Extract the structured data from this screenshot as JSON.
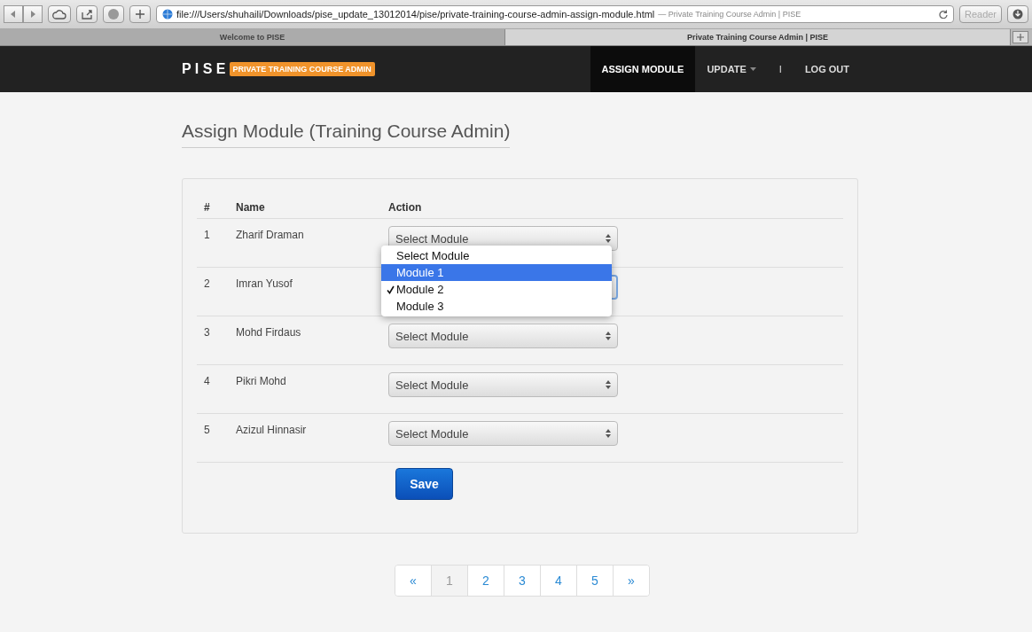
{
  "browser": {
    "url": "file:///Users/shuhaili/Downloads/pise_update_13012014/pise/private-training-course-admin-assign-module.html",
    "page_title": "— Private Training Course Admin | PISE",
    "reader": "Reader",
    "tabs": [
      {
        "label": "Welcome to PISE",
        "selected": false
      },
      {
        "label": "Private Training Course Admin | PISE",
        "selected": true
      }
    ]
  },
  "navbar": {
    "brand": "P I S E",
    "badge": "PRIVATE TRAINING COURSE ADMIN",
    "items": [
      {
        "label": "ASSIGN MODULE",
        "selected": true,
        "kind": "link"
      },
      {
        "label": "UPDATE",
        "selected": false,
        "kind": "dropdown"
      },
      {
        "label": "I",
        "kind": "separator"
      },
      {
        "label": "LOG OUT",
        "selected": false,
        "kind": "link"
      }
    ]
  },
  "heading": "Assign Module (Training Course Admin)",
  "table": {
    "columns": [
      "#",
      "Name",
      "Action"
    ],
    "rows": [
      {
        "number": "1",
        "name": "Zharif Draman",
        "value": "Select Module",
        "focused": false
      },
      {
        "number": "2",
        "name": "Imran Yusof",
        "focused": true
      },
      {
        "number": "3",
        "name": "Mohd Firdaus",
        "value": "Select Module",
        "focused": false
      },
      {
        "number": "4",
        "name": "Pikri Mohd",
        "value": "Select Module",
        "focused": false
      },
      {
        "number": "5",
        "name": "Azizul Hinnasir",
        "value": "Select Module",
        "focused": false
      }
    ]
  },
  "dropdown": {
    "options": [
      {
        "label": "Select Module",
        "checked": false,
        "highlighted": false
      },
      {
        "label": "Module 1",
        "checked": false,
        "highlighted": true
      },
      {
        "label": "Module 2",
        "checked": true,
        "highlighted": false
      },
      {
        "label": "Module 3",
        "checked": false,
        "highlighted": false
      }
    ]
  },
  "save_button": "Save",
  "pagination": [
    {
      "label": "«",
      "selected": false
    },
    {
      "label": "1",
      "selected": true
    },
    {
      "label": "2",
      "selected": false
    },
    {
      "label": "3",
      "selected": false
    },
    {
      "label": "4",
      "selected": false
    },
    {
      "label": "5",
      "selected": false
    },
    {
      "label": "»",
      "selected": false
    }
  ]
}
